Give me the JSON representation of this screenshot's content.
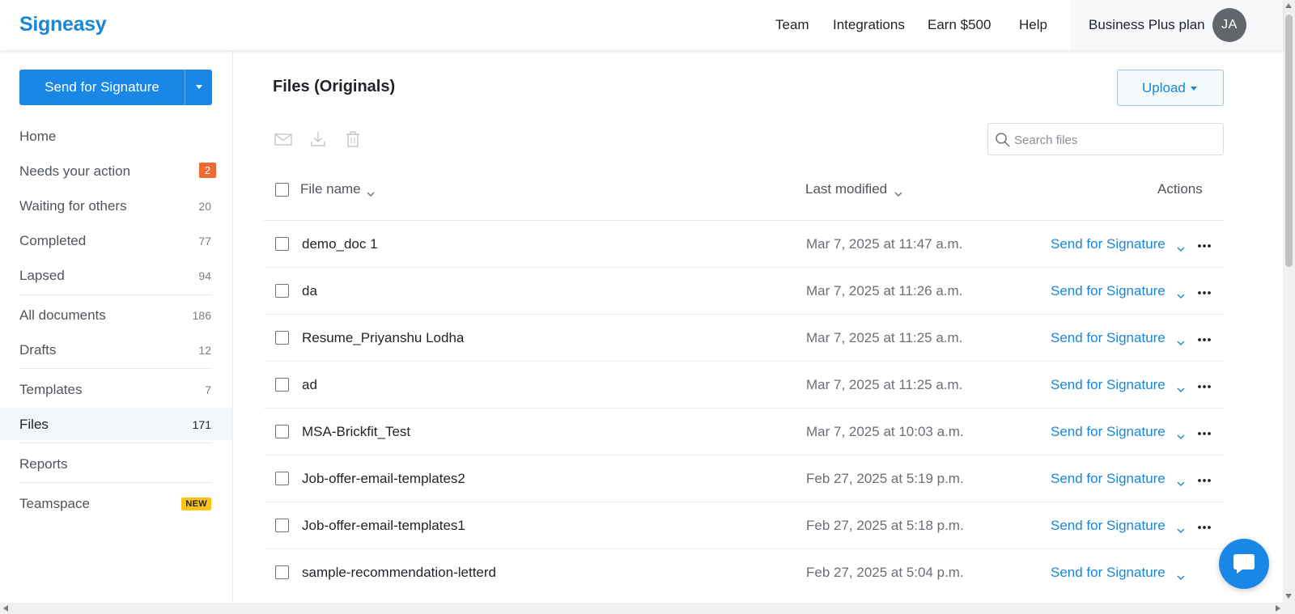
{
  "app": {
    "logo": "Signeasy"
  },
  "topnav": {
    "items": [
      {
        "label": "Team"
      },
      {
        "label": "Integrations"
      },
      {
        "label": "Earn $500"
      },
      {
        "label": "Help"
      }
    ],
    "plan_label": "Business Plus plan",
    "avatar_initials": "JA"
  },
  "sidebar": {
    "send_button_label": "Send for Signature",
    "items": [
      {
        "label": "Home",
        "count": ""
      },
      {
        "label": "Needs your action",
        "count": "2"
      },
      {
        "label": "Waiting for others",
        "count": "20"
      },
      {
        "label": "Completed",
        "count": "77"
      },
      {
        "label": "Lapsed",
        "count": "94"
      },
      {
        "label": "All documents",
        "count": "186"
      },
      {
        "label": "Drafts",
        "count": "12"
      },
      {
        "label": "Templates",
        "count": "7"
      },
      {
        "label": "Files",
        "count": "171",
        "active": true
      },
      {
        "label": "Reports",
        "count": ""
      },
      {
        "label": "Teamspace",
        "badge": "NEW"
      }
    ]
  },
  "main": {
    "title": "Files (Originals)",
    "upload_label": "Upload",
    "search_placeholder": "Search files",
    "toolbar_icons": [
      "email-icon",
      "download-icon",
      "trash-icon"
    ],
    "columns": {
      "file_name": "File name",
      "last_modified": "Last modified",
      "actions": "Actions"
    },
    "rows": [
      {
        "name": "demo_doc 1",
        "modified": "Mar 7, 2025 at 11:47 a.m.",
        "action": "Send for Signature"
      },
      {
        "name": "da",
        "modified": "Mar 7, 2025 at 11:26 a.m.",
        "action": "Send for Signature"
      },
      {
        "name": "Resume_Priyanshu Lodha",
        "modified": "Mar 7, 2025 at 11:25 a.m.",
        "action": "Send for Signature"
      },
      {
        "name": "ad",
        "modified": "Mar 7, 2025 at 11:25 a.m.",
        "action": "Send for Signature"
      },
      {
        "name": "MSA-Brickfit_Test",
        "modified": "Mar 7, 2025 at 10:03 a.m.",
        "action": "Send for Signature"
      },
      {
        "name": "Job-offer-email-templates2",
        "modified": "Feb 27, 2025 at 5:19 p.m.",
        "action": "Send for Signature"
      },
      {
        "name": "Job-offer-email-templates1",
        "modified": "Feb 27, 2025 at 5:18 p.m.",
        "action": "Send for Signature"
      },
      {
        "name": "sample-recommendation-letterd",
        "modified": "Feb 27, 2025 at 5:04 p.m.",
        "action": "Send for Signature"
      }
    ]
  },
  "colors": {
    "brand_blue": "#1a87e6",
    "link_blue": "#1a87d6",
    "needs_action_badge": "#ee6a34",
    "new_badge": "#fcc419"
  }
}
